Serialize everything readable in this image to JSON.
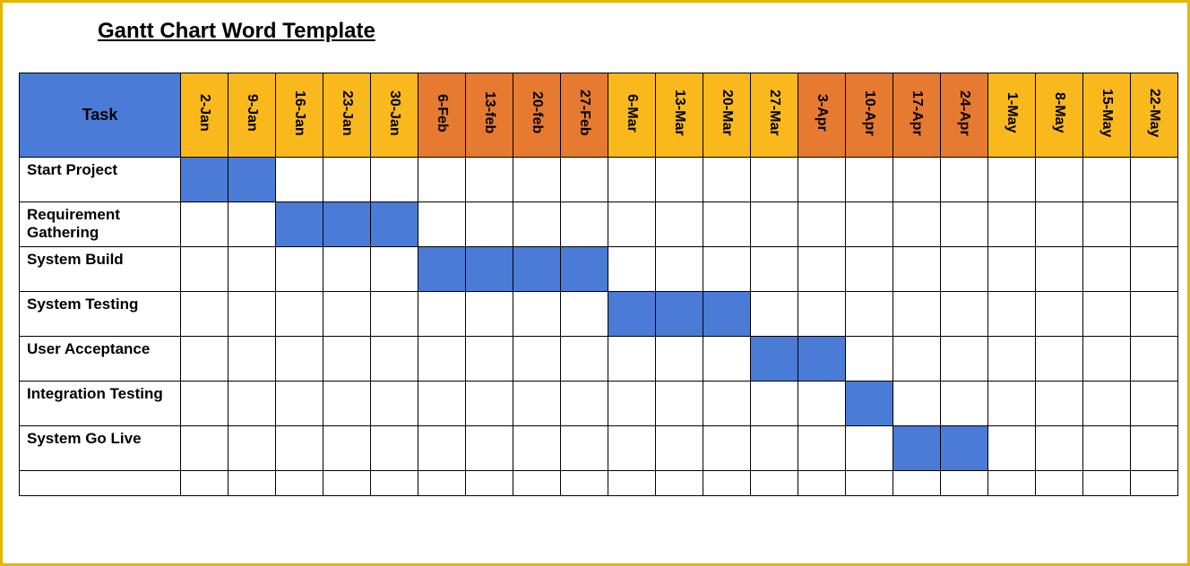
{
  "title": "Gantt Chart Word Template",
  "task_header": "Task",
  "dates": [
    {
      "label": "2-Jan",
      "month": "jan"
    },
    {
      "label": "9-Jan",
      "month": "jan"
    },
    {
      "label": "16-Jan",
      "month": "jan"
    },
    {
      "label": "23-Jan",
      "month": "jan"
    },
    {
      "label": "30-Jan",
      "month": "jan"
    },
    {
      "label": "6-Feb",
      "month": "feb"
    },
    {
      "label": "13-feb",
      "month": "feb"
    },
    {
      "label": "20-feb",
      "month": "feb"
    },
    {
      "label": "27-Feb",
      "month": "feb"
    },
    {
      "label": "6-Mar",
      "month": "mar"
    },
    {
      "label": "13-Mar",
      "month": "mar"
    },
    {
      "label": "20-Mar",
      "month": "mar"
    },
    {
      "label": "27-Mar",
      "month": "mar"
    },
    {
      "label": "3-Apr",
      "month": "apr"
    },
    {
      "label": "10-Apr",
      "month": "apr"
    },
    {
      "label": "17-Apr",
      "month": "apr"
    },
    {
      "label": "24-Apr",
      "month": "apr"
    },
    {
      "label": "1-May",
      "month": "may"
    },
    {
      "label": "8-May",
      "month": "may"
    },
    {
      "label": "15-May",
      "month": "may"
    },
    {
      "label": "22-May",
      "month": "may"
    }
  ],
  "tasks": [
    {
      "name": "Start Project",
      "bars": [
        0,
        1
      ]
    },
    {
      "name": "Requirement Gathering",
      "bars": [
        2,
        3,
        4
      ]
    },
    {
      "name": "System Build",
      "bars": [
        5,
        6,
        7,
        8
      ]
    },
    {
      "name": "System Testing",
      "bars": [
        9,
        10,
        11
      ]
    },
    {
      "name": "User Acceptance",
      "bars": [
        12,
        13
      ]
    },
    {
      "name": "Integration Testing",
      "bars": [
        14
      ]
    },
    {
      "name": "System Go Live",
      "bars": [
        15,
        16
      ]
    }
  ],
  "chart_data": {
    "type": "bar",
    "title": "Gantt Chart Word Template",
    "xlabel": "",
    "ylabel": "Task",
    "categories": [
      "2-Jan",
      "9-Jan",
      "16-Jan",
      "23-Jan",
      "30-Jan",
      "6-Feb",
      "13-feb",
      "20-feb",
      "27-Feb",
      "6-Mar",
      "13-Mar",
      "20-Mar",
      "27-Mar",
      "3-Apr",
      "10-Apr",
      "17-Apr",
      "24-Apr",
      "1-May",
      "8-May",
      "15-May",
      "22-May"
    ],
    "series": [
      {
        "name": "Start Project",
        "start": "2-Jan",
        "end": "9-Jan",
        "start_index": 0,
        "end_index": 1
      },
      {
        "name": "Requirement Gathering",
        "start": "16-Jan",
        "end": "30-Jan",
        "start_index": 2,
        "end_index": 4
      },
      {
        "name": "System Build",
        "start": "6-Feb",
        "end": "27-Feb",
        "start_index": 5,
        "end_index": 8
      },
      {
        "name": "System Testing",
        "start": "6-Mar",
        "end": "20-Mar",
        "start_index": 9,
        "end_index": 11
      },
      {
        "name": "User Acceptance",
        "start": "27-Mar",
        "end": "3-Apr",
        "start_index": 12,
        "end_index": 13
      },
      {
        "name": "Integration Testing",
        "start": "10-Apr",
        "end": "10-Apr",
        "start_index": 14,
        "end_index": 14
      },
      {
        "name": "System Go Live",
        "start": "17-Apr",
        "end": "24-Apr",
        "start_index": 15,
        "end_index": 16
      }
    ],
    "month_colors": {
      "jan": "#f9b81c",
      "feb": "#e67a30",
      "mar": "#f9b81c",
      "apr": "#e67a30",
      "may": "#f9b81c"
    },
    "bar_color": "#4a7bd6"
  }
}
